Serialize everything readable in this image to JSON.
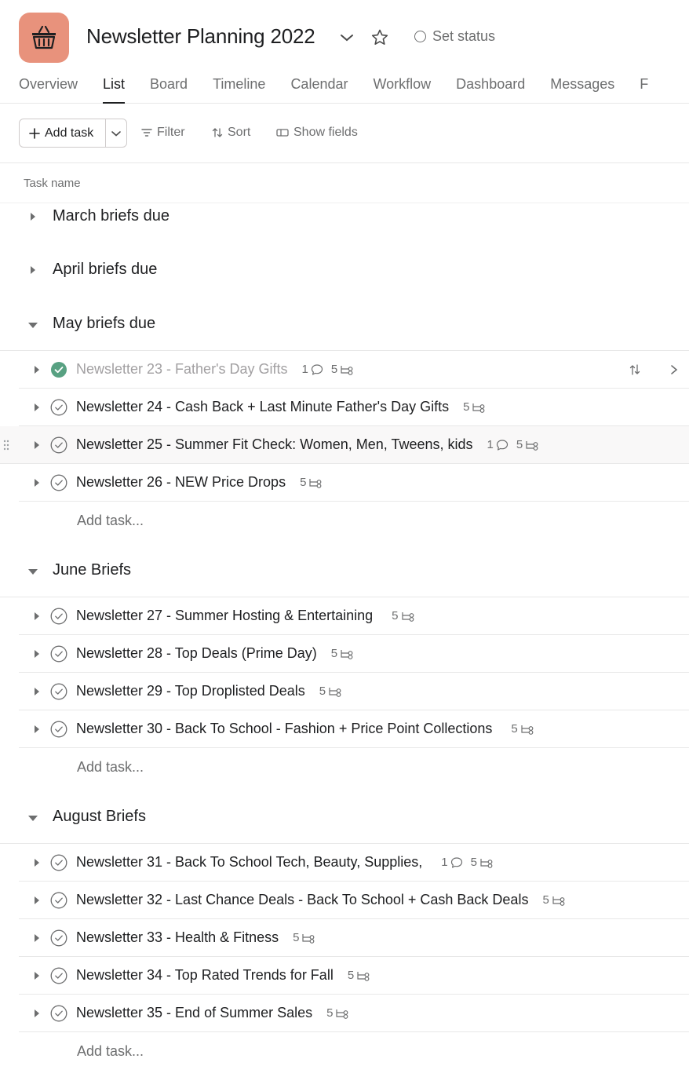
{
  "project": {
    "title": "Newsletter Planning 2022",
    "status_label": "Set status",
    "accent_color": "#e8927c"
  },
  "tabs": [
    {
      "label": "Overview",
      "active": false
    },
    {
      "label": "List",
      "active": true
    },
    {
      "label": "Board",
      "active": false
    },
    {
      "label": "Timeline",
      "active": false
    },
    {
      "label": "Calendar",
      "active": false
    },
    {
      "label": "Workflow",
      "active": false
    },
    {
      "label": "Dashboard",
      "active": false
    },
    {
      "label": "Messages",
      "active": false
    },
    {
      "label": "F",
      "active": false
    }
  ],
  "toolbar": {
    "add_task_label": "Add task",
    "filter_label": "Filter",
    "sort_label": "Sort",
    "show_fields_label": "Show fields"
  },
  "columns": {
    "task_name": "Task name"
  },
  "sections": [
    {
      "name": "March briefs due",
      "expanded": false,
      "tasks": []
    },
    {
      "name": "April briefs due",
      "expanded": false,
      "tasks": []
    },
    {
      "name": "May briefs due",
      "expanded": true,
      "add_task_label": "Add task...",
      "tasks": [
        {
          "name": "Newsletter 23 - Father's Day Gifts",
          "completed": true,
          "comments": "1",
          "subtasks": "5"
        },
        {
          "name": "Newsletter 24 - Cash Back + Last Minute Father's Day Gifts",
          "completed": false,
          "comments": "",
          "subtasks": "5"
        },
        {
          "name": "Newsletter 25 - Summer Fit Check: Women, Men, Tweens, kids",
          "completed": false,
          "comments": "1",
          "subtasks": "5"
        },
        {
          "name": "Newsletter 26 - NEW Price Drops",
          "completed": false,
          "comments": "",
          "subtasks": "5"
        }
      ]
    },
    {
      "name": "June Briefs",
      "expanded": true,
      "add_task_label": "Add task...",
      "tasks": [
        {
          "name": "Newsletter 27 - Summer Hosting & Entertaining",
          "completed": false,
          "comments": "",
          "subtasks": "5"
        },
        {
          "name": "Newsletter 28 - Top Deals (Prime Day)",
          "completed": false,
          "comments": "",
          "subtasks": "5"
        },
        {
          "name": "Newsletter 29 - Top Droplisted Deals",
          "completed": false,
          "comments": "",
          "subtasks": "5"
        },
        {
          "name": "Newsletter 30 - Back To School - Fashion + Price Point Collections",
          "completed": false,
          "comments": "",
          "subtasks": "5"
        }
      ]
    },
    {
      "name": "August Briefs",
      "expanded": true,
      "add_task_label": "Add task...",
      "tasks": [
        {
          "name": "Newsletter 31 - Back To School Tech, Beauty, Supplies,",
          "completed": false,
          "comments": "1",
          "subtasks": "5"
        },
        {
          "name": "Newsletter 32 - Last Chance Deals - Back To School + Cash Back Deals",
          "completed": false,
          "comments": "",
          "subtasks": "5"
        },
        {
          "name": "Newsletter 33 - Health & Fitness",
          "completed": false,
          "comments": "",
          "subtasks": "5"
        },
        {
          "name": "Newsletter 34 - Top Rated Trends for Fall",
          "completed": false,
          "comments": "",
          "subtasks": "5"
        },
        {
          "name": "Newsletter 35 - End of Summer Sales",
          "completed": false,
          "comments": "",
          "subtasks": "5"
        }
      ]
    }
  ]
}
